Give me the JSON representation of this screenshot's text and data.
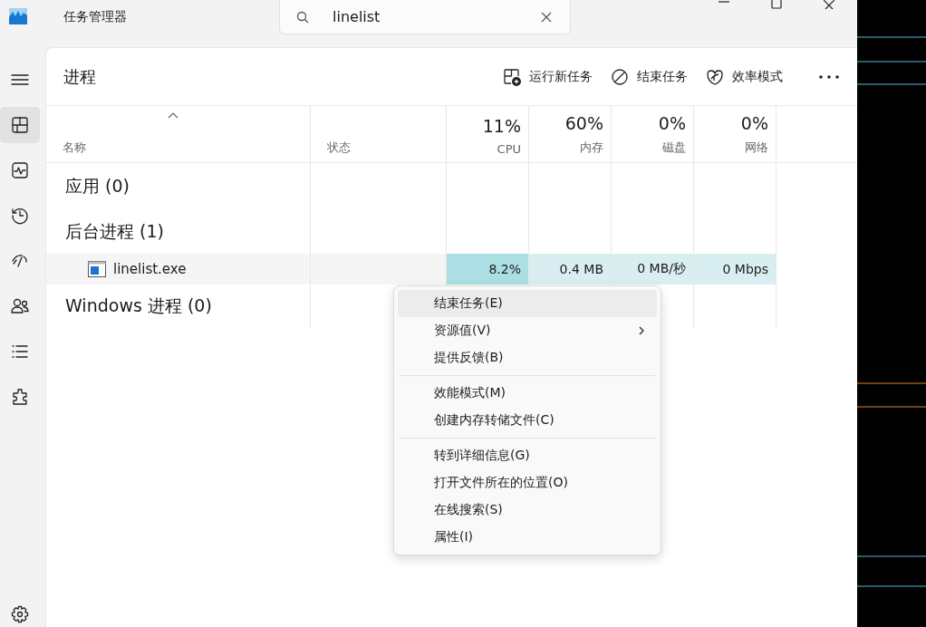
{
  "window": {
    "title": "任务管理器",
    "search": {
      "value": "linelist"
    }
  },
  "sidebar": {
    "items": [
      {
        "kind": "menu",
        "selected": false
      },
      {
        "kind": "processes",
        "selected": true
      },
      {
        "kind": "performance",
        "selected": false
      },
      {
        "kind": "history",
        "selected": false
      },
      {
        "kind": "startup",
        "selected": false
      },
      {
        "kind": "users",
        "selected": false
      },
      {
        "kind": "details",
        "selected": false
      },
      {
        "kind": "services",
        "selected": false
      }
    ],
    "footer": [
      {
        "kind": "settings",
        "selected": false
      }
    ]
  },
  "page": {
    "title": "进程",
    "toolbar": [
      {
        "kind": "run",
        "label": "运行新任务"
      },
      {
        "kind": "end",
        "label": "结束任务"
      },
      {
        "kind": "efficiency",
        "label": "效率模式"
      }
    ]
  },
  "table": {
    "columns": [
      {
        "label": "名称",
        "sorted": true
      },
      {
        "label": "状态",
        "sorted": false
      },
      {
        "percent": "11%",
        "label": "CPU",
        "sorted": false
      },
      {
        "percent": "60%",
        "label": "内存",
        "sorted": false
      },
      {
        "percent": "0%",
        "label": "磁盘",
        "sorted": false
      },
      {
        "percent": "0%",
        "label": "网络",
        "sorted": false
      }
    ],
    "rows": [
      {
        "kind": "group",
        "label": "应用 (0)"
      },
      {
        "kind": "group",
        "label": "后台进程 (1)"
      },
      {
        "kind": "process",
        "name": "linelist.exe",
        "cells": [
          {
            "value": "8.2%",
            "color": "#acdfe3"
          },
          {
            "value": "0.4 MB",
            "color": "#d9eef0"
          },
          {
            "value": "0 MB/秒",
            "color": "#d9eef0"
          },
          {
            "value": "0 Mbps",
            "color": "#d9eef0"
          }
        ]
      },
      {
        "kind": "group",
        "label": "Windows 进程 (0)"
      }
    ]
  },
  "context_menu": {
    "items": [
      {
        "kind": "item",
        "label": "结束任务(E)",
        "selected": true,
        "submenu": false
      },
      {
        "kind": "item",
        "label": "资源值(V)",
        "selected": false,
        "submenu": true
      },
      {
        "kind": "item",
        "label": "提供反馈(B)",
        "selected": false,
        "submenu": false
      },
      {
        "kind": "separator"
      },
      {
        "kind": "item",
        "label": "效能模式(M)",
        "selected": false,
        "submenu": false
      },
      {
        "kind": "item",
        "label": "创建内存转储文件(C)",
        "selected": false,
        "submenu": false
      },
      {
        "kind": "separator"
      },
      {
        "kind": "item",
        "label": "转到详细信息(G)",
        "selected": false,
        "submenu": false
      },
      {
        "kind": "item",
        "label": "打开文件所在的位置(O)",
        "selected": false,
        "submenu": false
      },
      {
        "kind": "item",
        "label": "在线搜索(S)",
        "selected": false,
        "submenu": false
      },
      {
        "kind": "item",
        "label": "属性(I)",
        "selected": false,
        "submenu": false
      }
    ]
  }
}
